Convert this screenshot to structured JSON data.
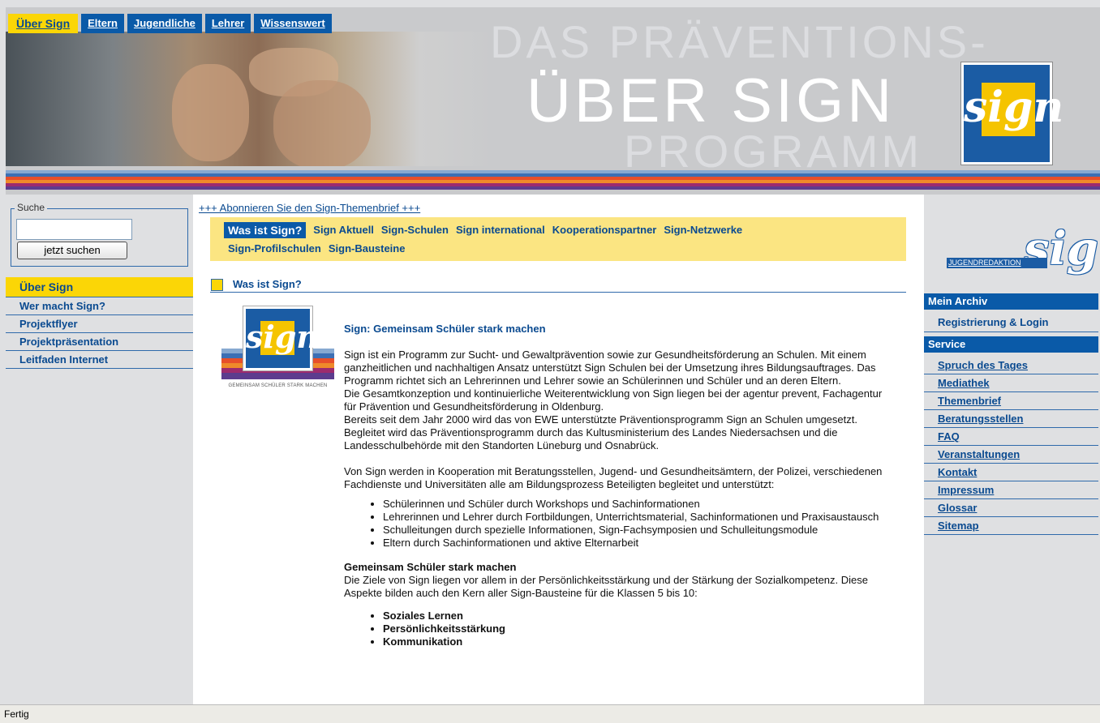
{
  "nav": {
    "tabs": [
      {
        "label": "Über Sign",
        "active": true
      },
      {
        "label": "Eltern",
        "active": false
      },
      {
        "label": "Jugendliche",
        "active": false
      },
      {
        "label": "Lehrer",
        "active": false
      },
      {
        "label": "Wissenswert",
        "active": false
      }
    ]
  },
  "header": {
    "headline_top": "DAS PRÄVENTIONS-",
    "headline_main": "ÜBER SIGN",
    "headline_bottom": "PROGRAMM",
    "logo_text": "sign"
  },
  "search": {
    "legend": "Suche",
    "input_value": "",
    "button_label": "jetzt suchen"
  },
  "leftnav": {
    "items": [
      {
        "label": "Über Sign",
        "active": true
      },
      {
        "label": "Wer macht Sign?",
        "active": false
      },
      {
        "label": "Projektflyer",
        "active": false
      },
      {
        "label": "Projektpräsentation",
        "active": false
      },
      {
        "label": "Leitfaden Internet",
        "active": false
      }
    ]
  },
  "main": {
    "subscribe_link": "+++ Abonnieren Sie den Sign-Themenbrief +++",
    "subnav_row1": [
      {
        "label": "Was ist Sign?",
        "active": true
      },
      {
        "label": "Sign Aktuell",
        "active": false
      },
      {
        "label": "Sign-Schulen",
        "active": false
      },
      {
        "label": "Sign international",
        "active": false
      },
      {
        "label": "Kooperationspartner",
        "active": false
      },
      {
        "label": "Sign-Netzwerke",
        "active": false
      }
    ],
    "subnav_row2": [
      {
        "label": "Sign-Profilschulen",
        "active": false
      },
      {
        "label": "Sign-Bausteine",
        "active": false
      }
    ],
    "section_title": "Was ist Sign?",
    "content_logo": {
      "text": "sign",
      "caption": "GEMEINSAM SCHÜLER STARK MACHEN"
    },
    "content": {
      "heading": "Sign: Gemeinsam Schüler stark machen",
      "p1": "Sign ist ein Programm zur Sucht- und Gewaltprävention sowie zur Gesundheitsförderung an Schulen. Mit einem ganzheitlichen und nachhaltigen Ansatz unterstützt Sign Schulen bei der Umsetzung ihres Bildungsauftrages. Das Programm richtet sich an Lehrerinnen und Lehrer sowie an Schülerinnen und Schüler und an deren Eltern.",
      "p2": "Die Gesamtkonzeption und kontinuierliche Weiterentwicklung von Sign liegen bei der agentur prevent, Fachagentur für Prävention und Gesundheitsförderung in Oldenburg.",
      "p3": "Bereits seit dem Jahr 2000 wird das von EWE unterstützte Präventionsprogramm Sign an Schulen umgesetzt. Begleitet wird das Präventionsprogramm durch das Kultusministerium des Landes Niedersachsen und die Landesschulbehörde mit den Standorten Lüneburg und Osnabrück.",
      "p4": "Von Sign werden in Kooperation mit Beratungsstellen, Jugend- und Gesundheitsämtern, der Polizei, verschiedenen Fachdienste und Universitäten alle am Bildungsprozess Beteiligten begleitet und unterstützt:",
      "list1": [
        "Schülerinnen und Schüler durch Workshops und Sachinformationen",
        "Lehrerinnen und Lehrer durch Fortbildungen, Unterrichtsmaterial, Sachinformationen und Praxisaustausch",
        "Schulleitungen durch spezielle Informationen, Sign-Fachsymposien und Schulleitungsmodule",
        "Eltern durch Sachinformationen und aktive Elternarbeit"
      ],
      "subheading": "Gemeinsam Schüler stark machen",
      "p5": "Die Ziele von Sign liegen vor allem in der Persönlichkeitsstärkung und der Stärkung der Sozialkompetenz. Diese Aspekte bilden auch den Kern aller Sign-Bausteine für die Klassen 5 bis 10:",
      "list2": [
        "Soziales Lernen",
        "Persönlichkeitsstärkung",
        "Kommunikation"
      ]
    }
  },
  "right": {
    "jugend_logo_text": "sign",
    "jugend_link": "JUGENDREDAKTION",
    "archive_head": "Mein Archiv",
    "archive_items": [
      "Registrierung & Login"
    ],
    "service_head": "Service",
    "service_items": [
      "Spruch des Tages",
      "Mediathek",
      "Themenbrief",
      "Beratungsstellen",
      "FAQ",
      "Veranstaltungen",
      "Kontakt",
      "Impressum",
      "Glossar",
      "Sitemap"
    ]
  },
  "status_bar": {
    "text": "Fertig"
  }
}
